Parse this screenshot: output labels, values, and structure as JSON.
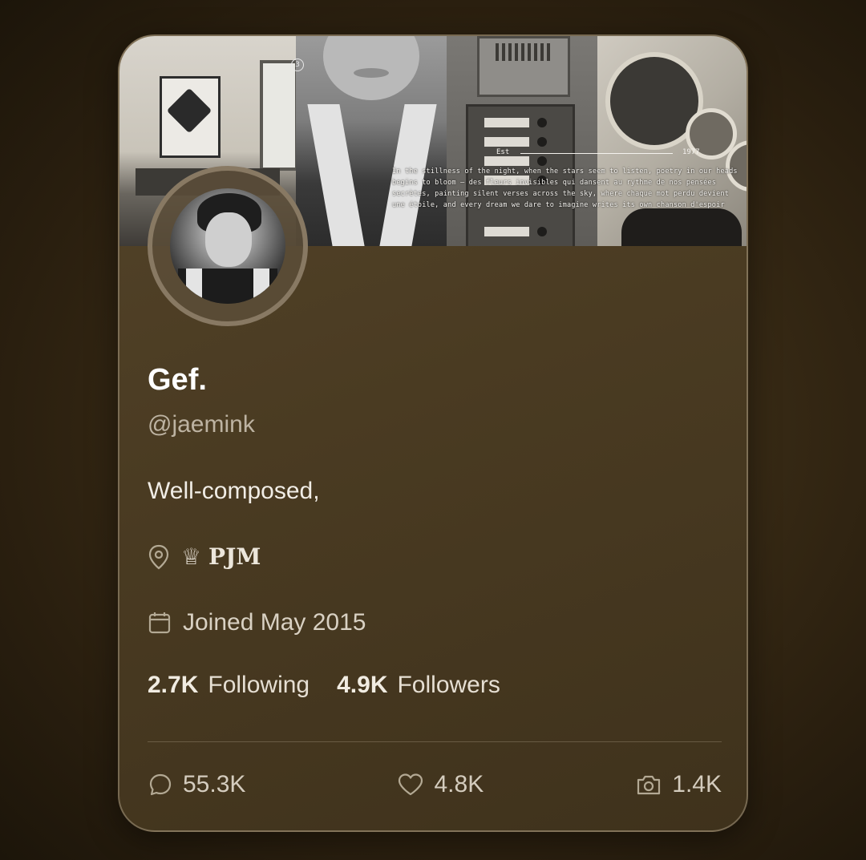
{
  "banner": {
    "est_label": "Est",
    "year": "1977",
    "poetry": "In the stillness of the night, when the stars seem to listen, poetry in our heads\nbegins to bloom — des fleurs invisibles qui dansent au rythme de nos pensées\nsecrètes, painting silent verses across the sky, where chaque mot perdu devient\nune étoile, and every dream we dare to imagine writes its own chanson d'espoir"
  },
  "profile": {
    "name": "Gef.",
    "handle": "@jaemink",
    "bio": "Well-composed,",
    "location_symbol": "♕",
    "location_text": "PJM",
    "joined": "Joined May 2015",
    "following_count": "2.7K",
    "following_label": "Following",
    "followers_count": "4.9K",
    "followers_label": "Followers"
  },
  "actions": {
    "comments": "55.3K",
    "likes": "4.8K",
    "photos": "1.4K"
  },
  "icons": {
    "location": "map-pin-icon",
    "calendar": "calendar-icon",
    "comment": "speech-bubble-icon",
    "like": "heart-icon",
    "photo": "camera-icon"
  },
  "colors": {
    "card_bg": "#54442a",
    "text_primary": "#ffffff",
    "text_muted": "#bdb3a2"
  }
}
